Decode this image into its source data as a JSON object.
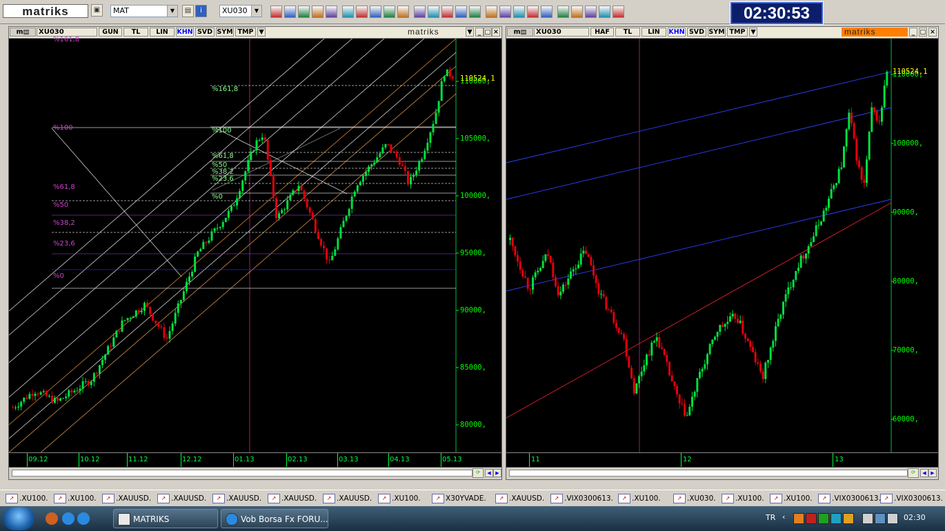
{
  "toolbar": {
    "logo": "matriks",
    "combo1": "MAT",
    "combo2": "XU030",
    "clock": "02:30:53",
    "icons": [
      "save-icon",
      "dropdown-icon",
      "page-icon",
      "info-icon",
      "pointer-icon",
      "chart-icon",
      "globe-icon",
      "swap-icon",
      "clock-icon",
      "refresh-icon",
      "home-icon",
      "letter-b-icon",
      "letter-a-icon",
      "letter-u-icon",
      "network-icon",
      "m-logo-icon",
      "eye-icon",
      "money-icon",
      "bars-icon",
      "window-icon",
      "note-icon",
      "chat-icon",
      "pen-icon",
      "layout-icon",
      "monitor-icon",
      "mail-icon",
      "print-icon",
      "message-icon",
      "refresh2-icon"
    ]
  },
  "left_window": {
    "symbol": "XU030",
    "tabs": [
      "GUN",
      "TL",
      "LIN",
      "KHN",
      "SVD",
      "SYM",
      "TMP"
    ],
    "active_tab": "KHN",
    "brand": "matriks",
    "last_price": "110524,1",
    "y_labels": [
      "110000,",
      "105000,",
      "100000,",
      "95000,",
      "90000,",
      "85000,",
      "80000,"
    ],
    "x_labels": [
      "09.12",
      "10.12",
      "11.12",
      "12.12",
      "01.13",
      "02.13",
      "03.13",
      "04.13",
      "05.13"
    ],
    "fib_left": [
      "%161,8",
      "%100",
      "%61,8",
      "%50",
      "%38,2",
      "%23,6",
      "%0"
    ],
    "fib_right": [
      "%161,8",
      "%100",
      "%61,8",
      "%50",
      "%38,2",
      "%23,6",
      "%0"
    ]
  },
  "right_window": {
    "symbol": "XU030",
    "tabs": [
      "HAF",
      "TL",
      "LIN",
      "KHN",
      "SVD",
      "SYM",
      "TMP"
    ],
    "active_tab": "KHN",
    "brand": "matriks",
    "last_price": "110524,1",
    "y_labels": [
      "110000,",
      "100000,",
      "90000,",
      "80000,",
      "70000,",
      "60000,"
    ],
    "x_labels": [
      "11",
      "12",
      "13"
    ]
  },
  "window_tabs": [
    ".XU100.",
    ".XU100.",
    ".XAUUSD.",
    ".XAUUSD.",
    ".XAUUSD.",
    ".XAUUSD.",
    ".XAUUSD.",
    ".XU100.",
    "X30YVADE.",
    ".XAUUSD.",
    ".VIX0300613.",
    ".XU100.",
    ".XU030.",
    ".XU100.",
    ".XU100.",
    ".VIX0300613.",
    ".VIX0300613."
  ],
  "taskbar": {
    "items": [
      "MATRIKS",
      "Vob Borsa Fx FORU..."
    ],
    "lang": "TR",
    "time": "02:30"
  },
  "colors": {
    "bull": "#00e040",
    "bear": "#e00010",
    "axis": "#00ff00",
    "last_price": "#ffff00",
    "fib_label": "#cc44cc",
    "fib_label_mid": "#88ff88"
  }
}
